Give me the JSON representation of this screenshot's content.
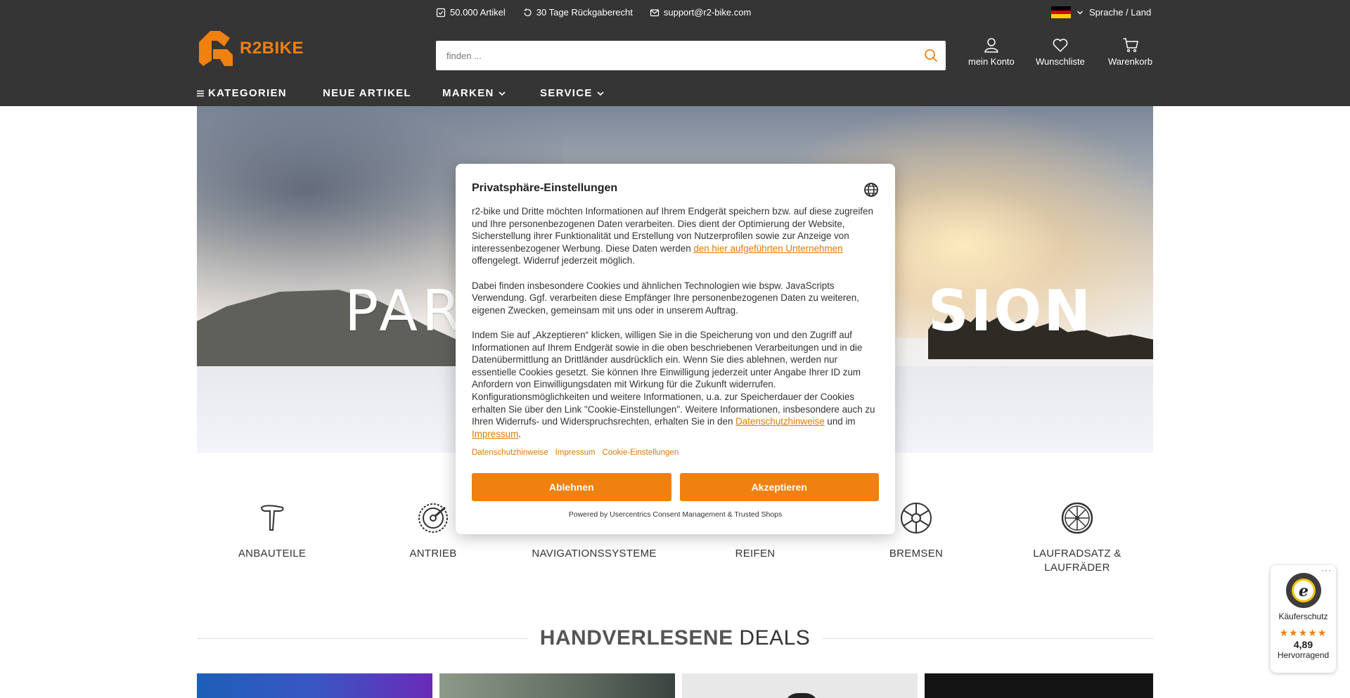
{
  "topbar": {
    "items": [
      {
        "label": "50.000 Artikel",
        "icon": "check-square-icon"
      },
      {
        "label": "30 Tage Rückgaberecht",
        "icon": "return-arrow-icon"
      },
      {
        "label": "support@r2-bike.com",
        "icon": "mail-icon"
      }
    ],
    "language_label": "Sprache / Land",
    "flag": "de-flag-icon"
  },
  "logo": {
    "text": "R2BIKE",
    "color": "#f08010"
  },
  "search": {
    "placeholder": "finden ..."
  },
  "header_icons": {
    "account": "mein Konto",
    "wishlist": "Wunschliste",
    "cart": "Warenkorb"
  },
  "nav": {
    "categories": "KATEGORIEN",
    "new_items": "NEUE ARTIKEL",
    "brands": "MARKEN",
    "service": "SERVICE"
  },
  "hero": {
    "title_start": "PART",
    "title_end": "SION"
  },
  "categories": [
    {
      "label": "ANBAUTEILE",
      "icon": "seatpost-icon"
    },
    {
      "label": "ANTRIEB",
      "icon": "chainring-icon"
    },
    {
      "label": "NAVIGATIONSSYSTEME",
      "icon": "gps-device-icon"
    },
    {
      "label": "REIFEN",
      "icon": "tire-icon"
    },
    {
      "label": "BREMSEN",
      "icon": "brake-disc-icon"
    },
    {
      "label": "LAUFRADSATZ & LAUFRÄDER",
      "icon": "wheel-icon"
    }
  ],
  "deals": {
    "title_bold": "HANDVERLESENE",
    "title_rest": "DEALS"
  },
  "consent": {
    "title": "Privatsphäre-Einstellungen",
    "p1_text": "r2-bike und Dritte möchten Informationen auf Ihrem Endgerät speichern bzw. auf diese zugreifen und Ihre personenbezogenen Daten verarbeiten. Dies dient der Optimierung der Website, Sicherstellung ihrer Funktionalität und Erstellung von Nutzerprofilen sowie zur Anzeige von interessenbezogener Werbung. Diese Daten werden ",
    "p1_link": "den hier aufgeführten Unternehmen",
    "p1_end": " offengelegt. Widerruf jederzeit möglich.",
    "p2": "Dabei finden insbesondere Cookies und ähnlichen Technologien wie bspw. JavaScripts Verwendung. Ggf. verarbeiten diese Empfänger Ihre personenbezogenen Daten zu weiteren, eigenen Zwecken, gemeinsam mit uns oder in unserem Auftrag.",
    "p3_text": "Indem Sie auf „Akzeptieren“ klicken, willigen Sie in die Speicherung von und den Zugriff auf Informationen auf Ihrem Endgerät sowie in die oben beschriebenen Verarbeitungen und in die Datenübermittlung an Drittländer ausdrücklich ein. Wenn Sie dies ablehnen, werden nur essentielle Cookies gesetzt. Sie können Ihre Einwilligung jederzeit unter Angabe Ihrer ID zum Anfordern von Einwilligungsdaten mit Wirkung für die Zukunft widerrufen. Konfigurationsmöglichkeiten und weitere Informationen, u.a. zur Speicherdauer der Cookies erhalten Sie über den Link \"Cookie-Einstellungen\". Weitere Informationen, insbesondere auch zu Ihren Widerrufs- und Widerspruchsrechten, erhalten Sie in den ",
    "p3_link1": "Datenschutzhinweise",
    "p3_mid": " und im ",
    "p3_link2": "Impressum",
    "p3_end": ".",
    "links": [
      "Datenschutzhinweise",
      "Impressum",
      "Cookie-Einstellungen"
    ],
    "deny": "Ablehnen",
    "accept": "Akzeptieren",
    "powered": "Powered by Usercentrics Consent Management & Trusted Shops"
  },
  "trust": {
    "label": "Käuferschutz",
    "stars": "★★★★★",
    "score": "4,89",
    "grade": "Hervorragend",
    "more": "···"
  },
  "colors": {
    "accent": "#f08010",
    "header_bg": "#353535"
  }
}
